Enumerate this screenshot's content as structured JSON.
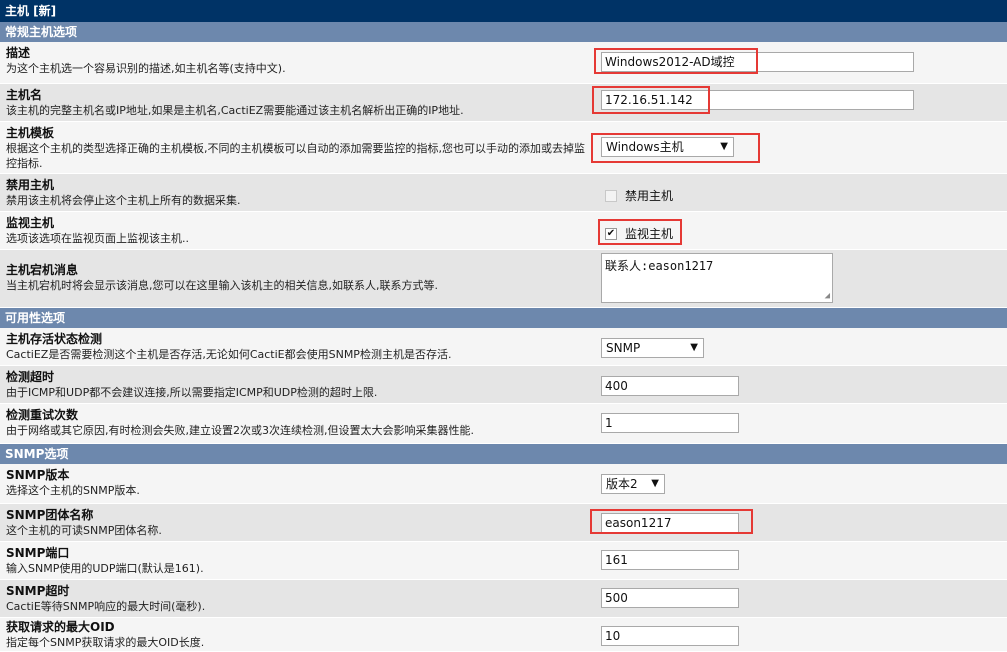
{
  "page": {
    "title": "主机 [新]"
  },
  "sections": {
    "general": "常规主机选项",
    "availability": "可用性选项",
    "snmp": "SNMP选项"
  },
  "fields": {
    "description": {
      "label": "描述",
      "help": "为这个主机选一个容易识别的描述,如主机名等(支持中文).",
      "value": "Windows2012-AD域控"
    },
    "hostname": {
      "label": "主机名",
      "help": "该主机的完整主机名或IP地址,如果是主机名,CactiEZ需要能通过该主机名解析出正确的IP地址.",
      "value": "172.16.51.142"
    },
    "template": {
      "label": "主机模板",
      "help": "根据这个主机的类型选择正确的主机模板,不同的主机模板可以自动的添加需要监控的指标,您也可以手动的添加或去掉监控指标.",
      "value": "Windows主机"
    },
    "disable": {
      "label": "禁用主机",
      "help": "禁用该主机将会停止这个主机上所有的数据采集.",
      "checkbox_label": "禁用主机",
      "checked": false
    },
    "monitor": {
      "label": "监视主机",
      "help": "选项该选项在监视页面上监视该主机..",
      "checkbox_label": "监视主机",
      "checked": true,
      "checkmark": "✔"
    },
    "down_message": {
      "label": "主机宕机消息",
      "help": "当主机宕机时将会显示该消息,您可以在这里输入该机主的相关信息,如联系人,联系方式等.",
      "value": "联系人:eason1217"
    },
    "availability_method": {
      "label": "主机存活状态检测",
      "help": "CactiEZ是否需要检测这个主机是否存活,无论如何CactiE都会使用SNMP检测主机是否存活.",
      "value": "SNMP"
    },
    "ping_timeout": {
      "label": "检测超时",
      "help": "由于ICMP和UDP都不会建议连接,所以需要指定ICMP和UDP检测的超时上限.",
      "value": "400"
    },
    "ping_retries": {
      "label": "检测重试次数",
      "help": "由于网络或其它原因,有时检测会失败,建立设置2次或3次连续检测,但设置太大会影响采集器性能.",
      "value": "1"
    },
    "snmp_version": {
      "label": "SNMP版本",
      "help": "选择这个主机的SNMP版本.",
      "value": "版本2"
    },
    "snmp_community": {
      "label": "SNMP团体名称",
      "help": "这个主机的可读SNMP团体名称.",
      "value": "eason1217"
    },
    "snmp_port": {
      "label": "SNMP端口",
      "help": "输入SNMP使用的UDP端口(默认是161).",
      "value": "161"
    },
    "snmp_timeout": {
      "label": "SNMP超时",
      "help": "CactiE等待SNMP响应的最大时间(毫秒).",
      "value": "500"
    },
    "max_oids": {
      "label": "获取请求的最大OID",
      "help": "指定每个SNMP获取请求的最大OID长度.",
      "value": "10"
    }
  },
  "icons": {
    "dropdown": "▼",
    "resize_grip": "◢"
  },
  "colors": {
    "title_bar": "#003366",
    "section_bar": "#6d88ad",
    "highlight": "#e53935"
  }
}
